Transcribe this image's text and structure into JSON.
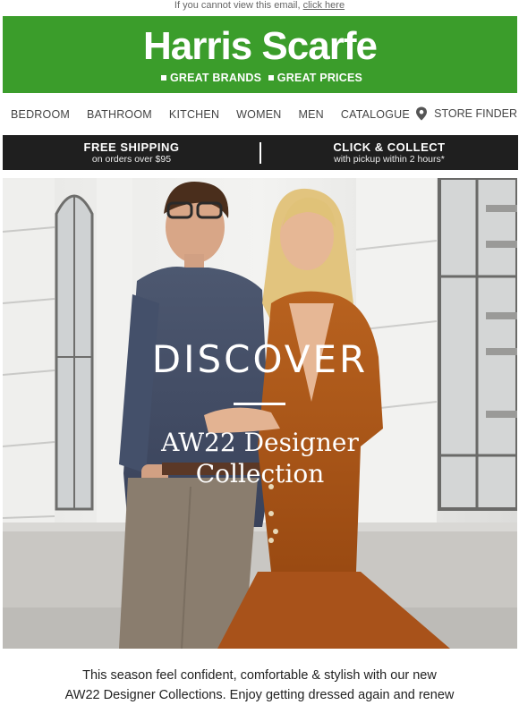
{
  "preheader": {
    "text": "If you cannot view this email,",
    "link": "click here"
  },
  "brand": {
    "name": "Harris Scarfe",
    "tagline_1": "GREAT BRANDS",
    "tagline_2": "GREAT PRICES",
    "color": "#3b9d2b"
  },
  "nav": {
    "items": [
      "BEDROOM",
      "BATHROOM",
      "KITCHEN",
      "WOMEN",
      "MEN",
      "CATALOGUE"
    ],
    "store_finder": "STORE FINDER",
    "store_finder_icon": "location-pin-icon"
  },
  "promo": {
    "left_title": "FREE SHIPPING",
    "left_sub": "on orders over $95",
    "right_title": "CLICK & COLLECT",
    "right_sub": "with pickup within 2 hours*"
  },
  "hero": {
    "headline": "DISCOVER",
    "subheadline_1": "AW22 Designer",
    "subheadline_2": "Collection"
  },
  "body": {
    "copy_line_1": "This season feel confident, comfortable & stylish with our new",
    "copy_line_2": "AW22 Designer Collections. Enjoy getting dressed again and renew"
  }
}
